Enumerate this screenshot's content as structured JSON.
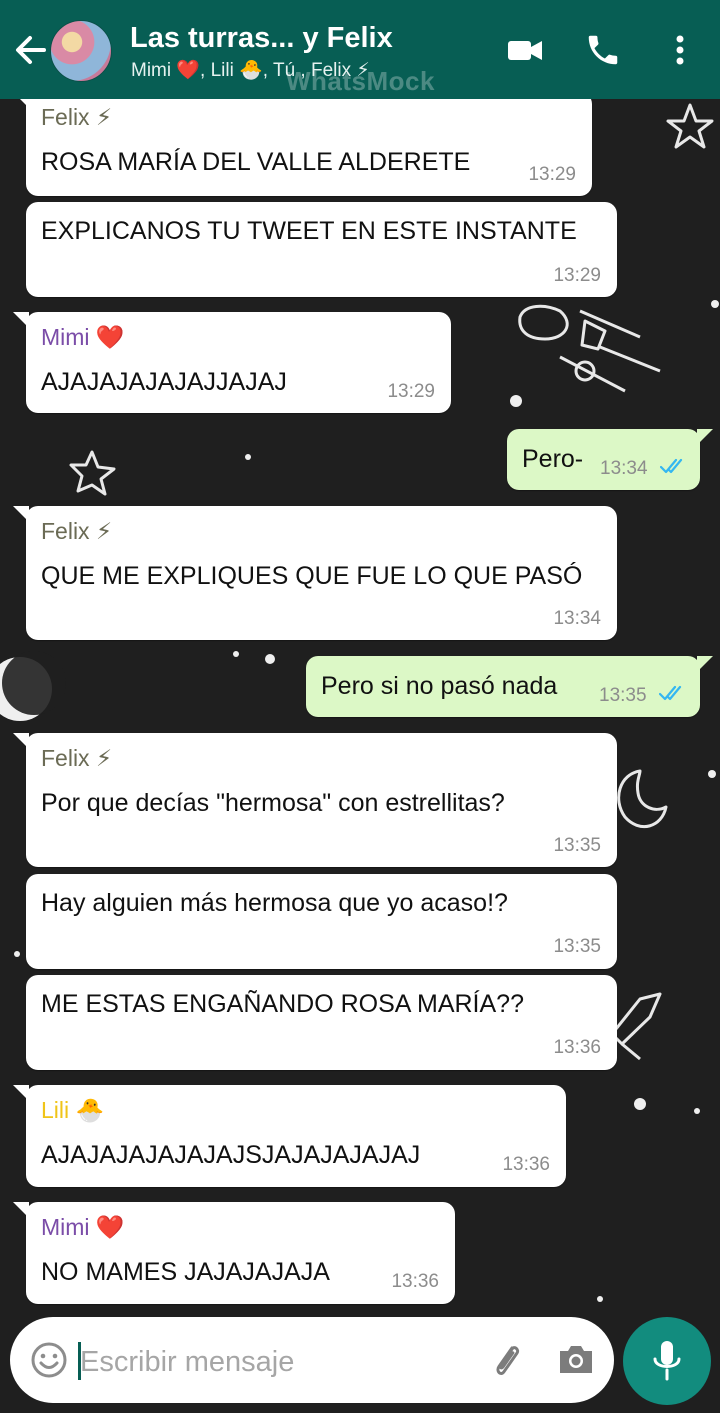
{
  "header": {
    "title": "Las turras... y Felix",
    "subtitle": "Mimi ❤️, Lili 🐣, Tú , Felix ⚡",
    "watermark": "WhatsMock",
    "back_icon": "arrow-left-icon",
    "video_icon": "video-camera-icon",
    "call_icon": "phone-icon",
    "menu_icon": "more-vertical-icon"
  },
  "colors": {
    "header": "#075e54",
    "incoming_bubble": "#ffffff",
    "outgoing_bubble": "#dcf8c6",
    "mic_button": "#128c7e",
    "read_ticks": "#34b7f1",
    "felix_name": "#6b6b55",
    "mimi_name": "#7b4da8",
    "lili_name": "#f0c419"
  },
  "messages": [
    {
      "sender": "Felix ⚡",
      "text": "ROSA MARÍA DEL VALLE ALDERETE",
      "time": "13:29",
      "direction": "in"
    },
    {
      "sender": "",
      "text": "EXPLICANOS TU TWEET EN ESTE INSTANTE",
      "time": "13:29",
      "direction": "in"
    },
    {
      "sender": "Mimi ❤️",
      "text": "AJAJAJAJAJAJJAJAJ",
      "time": "13:29",
      "direction": "in"
    },
    {
      "sender": "",
      "text": "Pero-",
      "time": "13:34",
      "direction": "out",
      "status": "read"
    },
    {
      "sender": "Felix ⚡",
      "text": "QUE ME EXPLIQUES QUE FUE LO QUE PASÓ",
      "time": "13:34",
      "direction": "in"
    },
    {
      "sender": "",
      "text": "Pero si no pasó nada",
      "time": "13:35",
      "direction": "out",
      "status": "read"
    },
    {
      "sender": "Felix ⚡",
      "text": "Por que decías \"hermosa\" con estrellitas?",
      "time": "13:35",
      "direction": "in"
    },
    {
      "sender": "",
      "text": "Hay alguien más hermosa que yo acaso!?",
      "time": "13:35",
      "direction": "in"
    },
    {
      "sender": "",
      "text": "ME ESTAS ENGAÑANDO ROSA MARÍA??",
      "time": "13:36",
      "direction": "in"
    },
    {
      "sender": "Lili 🐣",
      "text": "AJAJAJAJAJAJAJSJAJAJAJAJAJ",
      "time": "13:36",
      "direction": "in"
    },
    {
      "sender": "Mimi ❤️",
      "text": "NO MAMES JAJAJAJAJA",
      "time": "13:36",
      "direction": "in"
    }
  ],
  "composer": {
    "placeholder": "Escribir mensaje",
    "emoji_icon": "emoji-icon",
    "attach_icon": "paperclip-icon",
    "camera_icon": "camera-icon",
    "mic_icon": "microphone-icon"
  }
}
